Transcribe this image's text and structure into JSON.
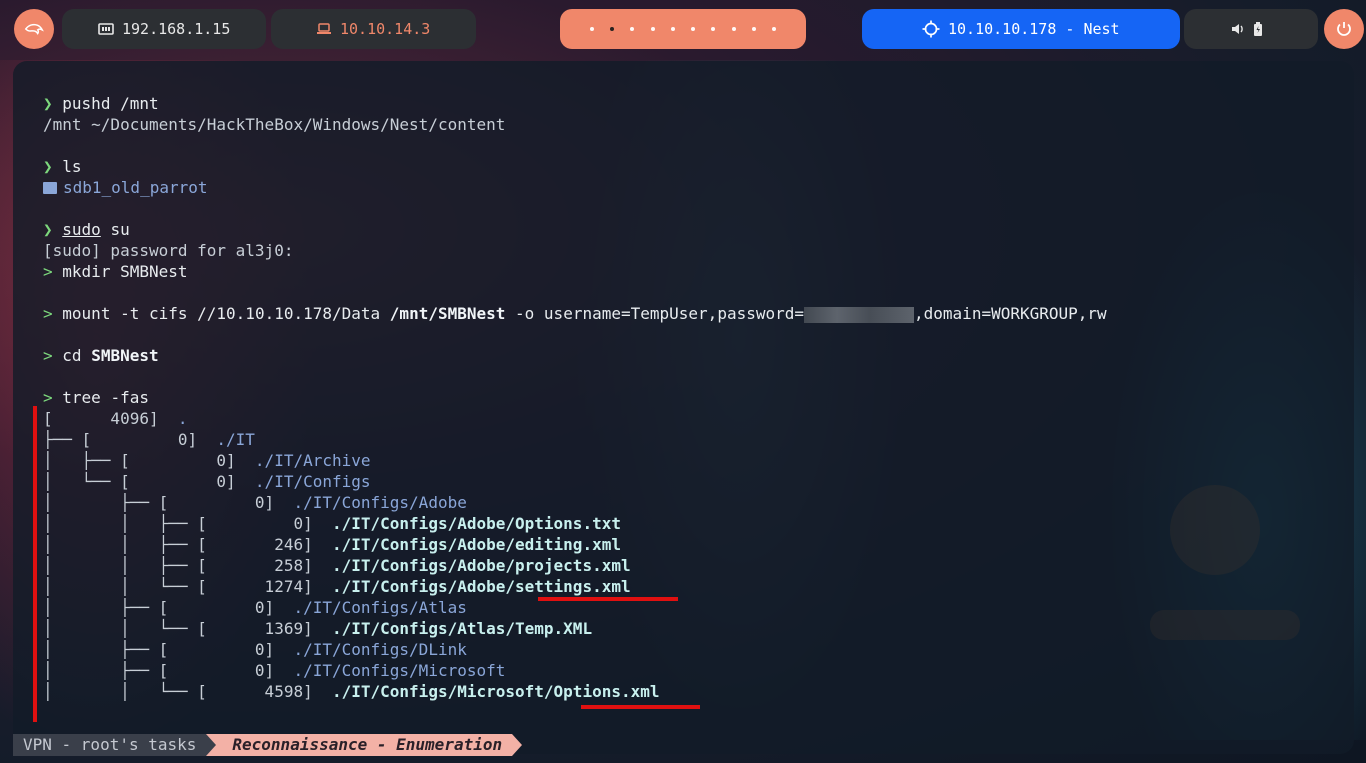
{
  "topbar": {
    "local_ip": "192.168.1.15",
    "vpn_ip": "10.10.14.3",
    "target": "10.10.10.178 - Nest",
    "workspaces": 10,
    "active_workspace": 2
  },
  "terminal": {
    "lines": [
      "pushd /mnt",
      "/mnt ~/Documents/HackTheBox/Windows/Nest/content",
      "ls",
      "sdb1_old_parrot",
      "sudo su",
      "[sudo] password for al3j0:",
      "mkdir SMBNest",
      "mount -t cifs //10.10.10.178/Data /mnt/SMBNest -o username=TempUser,password=",
      ",domain=WORKGROUP,rw",
      "cd SMBNest",
      "tree -fas"
    ],
    "prompt_char": "❯",
    "root_prompt": ">",
    "tree": [
      {
        "prefix": "[",
        "size": "4096",
        "path": "."
      },
      {
        "prefix": "├── [",
        "size": "0",
        "path": "./IT"
      },
      {
        "prefix": "│   ├── [",
        "size": "0",
        "path": "./IT/Archive"
      },
      {
        "prefix": "│   └── [",
        "size": "0",
        "path": "./IT/Configs"
      },
      {
        "prefix": "│       ├── [",
        "size": "0",
        "path": "./IT/Configs/Adobe"
      },
      {
        "prefix": "│       │   ├── [",
        "size": "0",
        "path": "./IT/Configs/Adobe/Options.txt"
      },
      {
        "prefix": "│       │   ├── [",
        "size": "246",
        "path": "./IT/Configs/Adobe/editing.xml"
      },
      {
        "prefix": "│       │   ├── [",
        "size": "258",
        "path": "./IT/Configs/Adobe/projects.xml"
      },
      {
        "prefix": "│       │   └── [",
        "size": "1274",
        "path": "./IT/Configs/Adobe/settings.xml"
      },
      {
        "prefix": "│       ├── [",
        "size": "0",
        "path": "./IT/Configs/Atlas"
      },
      {
        "prefix": "│       │   └── [",
        "size": "1369",
        "path": "./IT/Configs/Atlas/Temp.XML"
      },
      {
        "prefix": "│       ├── [",
        "size": "0",
        "path": "./IT/Configs/DLink"
      },
      {
        "prefix": "│       ├── [",
        "size": "0",
        "path": "./IT/Configs/Microsoft"
      },
      {
        "prefix": "│       │   └── [",
        "size": "4598",
        "path": "./IT/Configs/Microsoft/Options.xml"
      }
    ]
  },
  "status": {
    "session": "VPN - root's tasks",
    "window": "Reconnaissance - Enumeration"
  },
  "colors": {
    "accent_orange": "#f0876a",
    "accent_blue": "#1565f5",
    "highlight_red": "#e01010"
  },
  "icons": [
    "kali-dragon-icon",
    "network-card-icon",
    "laptop-icon",
    "target-crosshair-icon",
    "volume-icon",
    "battery-icon",
    "power-icon",
    "folder-icon"
  ]
}
